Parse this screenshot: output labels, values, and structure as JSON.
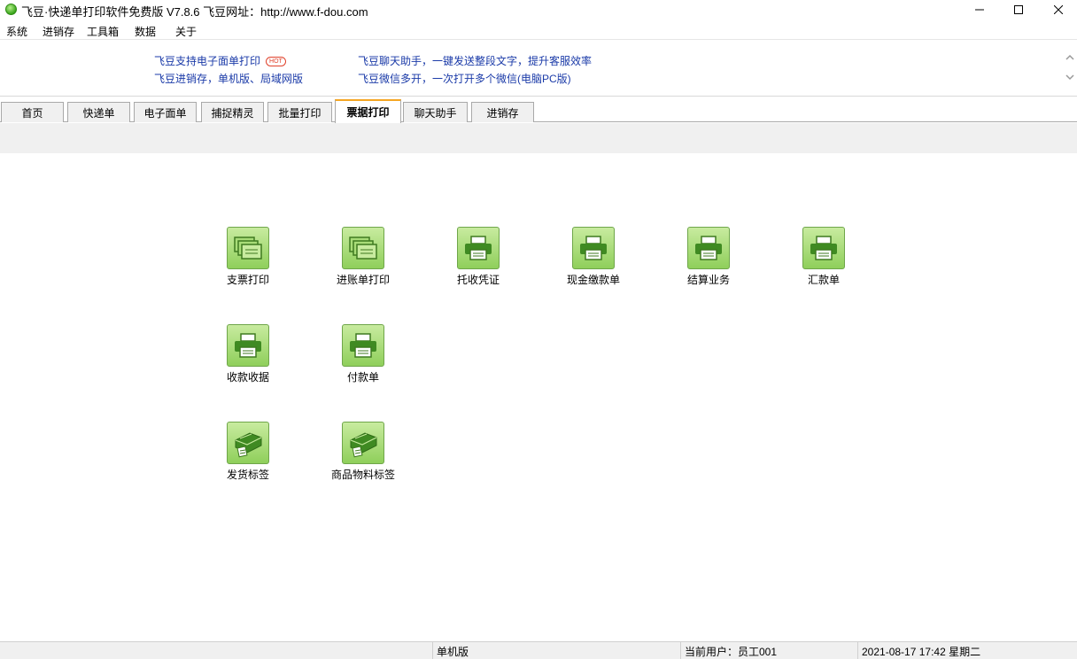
{
  "window": {
    "title": "飞豆·快递单打印软件免费版 V7.8.6  飞豆网址：http://www.f-dou.com"
  },
  "menu": [
    "系统",
    "进销存",
    "工具箱",
    "数据",
    "关于"
  ],
  "banner": {
    "links_left": [
      "飞豆支持电子面单打印",
      "飞豆进销存，单机版、局域网版"
    ],
    "hot_badge": "HOT",
    "links_right": [
      "飞豆聊天助手，一键发送整段文字，提升客服效率",
      "飞豆微信多开，一次打开多个微信(电脑PC版)"
    ]
  },
  "tabs": [
    {
      "label": "首页",
      "active": false
    },
    {
      "label": "快递单",
      "active": false
    },
    {
      "label": "电子面单",
      "active": false
    },
    {
      "label": "捕捉精灵",
      "active": false
    },
    {
      "label": "批量打印",
      "active": false
    },
    {
      "label": "票据打印",
      "active": true
    },
    {
      "label": "聊天助手",
      "active": false
    },
    {
      "label": "进销存",
      "active": false
    }
  ],
  "tiles": [
    {
      "label": "支票打印",
      "icon": "stack-printer-icon"
    },
    {
      "label": "进账单打印",
      "icon": "stack-printer-icon"
    },
    {
      "label": "托收凭证",
      "icon": "printer-icon"
    },
    {
      "label": "现金缴款单",
      "icon": "printer-icon"
    },
    {
      "label": "结算业务",
      "icon": "printer-icon"
    },
    {
      "label": "汇款单",
      "icon": "printer-icon"
    },
    {
      "label": "收款收据",
      "icon": "printer-icon"
    },
    {
      "label": "付款单",
      "icon": "printer-icon"
    },
    {
      "label": "发货标签",
      "icon": "label-printer-icon"
    },
    {
      "label": "商品物料标签",
      "icon": "label-printer-icon"
    }
  ],
  "status": {
    "mode": "单机版",
    "user": "当前用户：员工001",
    "datetime": "2021-08-17 17:42 星期二"
  },
  "colors": {
    "tile_bg": "#a8dc78",
    "tile_border": "#6fa64a",
    "link": "#1a3aa8",
    "active_tab_accent": "#f5a623"
  }
}
